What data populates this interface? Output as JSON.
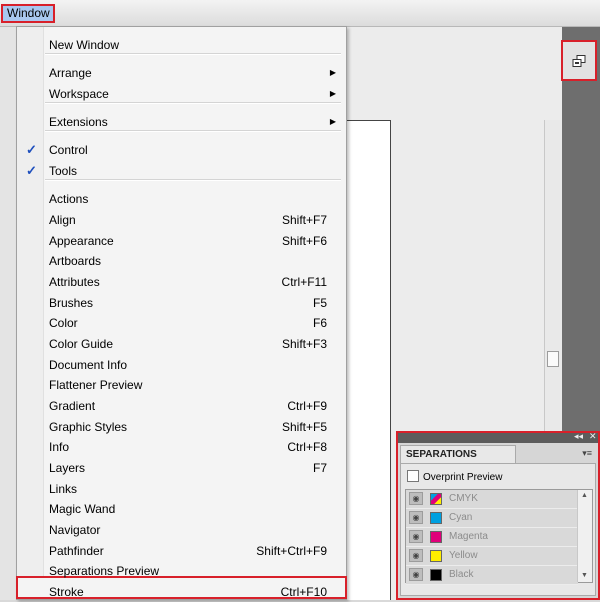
{
  "menubar": {
    "window_label": "Window"
  },
  "menu": {
    "items": [
      {
        "label": "New Window",
        "shortcut": "",
        "submenu": false,
        "checked": false
      },
      {
        "label": "Arrange",
        "shortcut": "",
        "submenu": true,
        "checked": false
      },
      {
        "label": "Workspace",
        "shortcut": "",
        "submenu": true,
        "checked": false
      },
      {
        "label": "Extensions",
        "shortcut": "",
        "submenu": true,
        "checked": false
      },
      {
        "label": "Control",
        "shortcut": "",
        "submenu": false,
        "checked": true
      },
      {
        "label": "Tools",
        "shortcut": "",
        "submenu": false,
        "checked": true
      },
      {
        "label": "Actions",
        "shortcut": "",
        "submenu": false,
        "checked": false
      },
      {
        "label": "Align",
        "shortcut": "Shift+F7",
        "submenu": false,
        "checked": false
      },
      {
        "label": "Appearance",
        "shortcut": "Shift+F6",
        "submenu": false,
        "checked": false
      },
      {
        "label": "Artboards",
        "shortcut": "",
        "submenu": false,
        "checked": false
      },
      {
        "label": "Attributes",
        "shortcut": "Ctrl+F11",
        "submenu": false,
        "checked": false
      },
      {
        "label": "Brushes",
        "shortcut": "F5",
        "submenu": false,
        "checked": false
      },
      {
        "label": "Color",
        "shortcut": "F6",
        "submenu": false,
        "checked": false
      },
      {
        "label": "Color Guide",
        "shortcut": "Shift+F3",
        "submenu": false,
        "checked": false
      },
      {
        "label": "Document Info",
        "shortcut": "",
        "submenu": false,
        "checked": false
      },
      {
        "label": "Flattener Preview",
        "shortcut": "",
        "submenu": false,
        "checked": false
      },
      {
        "label": "Gradient",
        "shortcut": "Ctrl+F9",
        "submenu": false,
        "checked": false
      },
      {
        "label": "Graphic Styles",
        "shortcut": "Shift+F5",
        "submenu": false,
        "checked": false
      },
      {
        "label": "Info",
        "shortcut": "Ctrl+F8",
        "submenu": false,
        "checked": false
      },
      {
        "label": "Layers",
        "shortcut": "F7",
        "submenu": false,
        "checked": false
      },
      {
        "label": "Links",
        "shortcut": "",
        "submenu": false,
        "checked": false
      },
      {
        "label": "Magic Wand",
        "shortcut": "",
        "submenu": false,
        "checked": false
      },
      {
        "label": "Navigator",
        "shortcut": "",
        "submenu": false,
        "checked": false
      },
      {
        "label": "Pathfinder",
        "shortcut": "Shift+Ctrl+F9",
        "submenu": false,
        "checked": false
      },
      {
        "label": "Separations Preview",
        "shortcut": "",
        "submenu": false,
        "checked": false,
        "highlighted": true
      },
      {
        "label": "Stroke",
        "shortcut": "Ctrl+F10",
        "submenu": false,
        "checked": false
      }
    ],
    "check_glyph": "✓",
    "arrow_glyph": "▶"
  },
  "separations_panel": {
    "title": "SEPARATIONS PREVIEW",
    "overprint_label": "Overprint Preview",
    "inks": [
      {
        "name": "CMYK",
        "color": "multi"
      },
      {
        "name": "Cyan",
        "color": "#00a0e0"
      },
      {
        "name": "Magenta",
        "color": "#e0007a"
      },
      {
        "name": "Yellow",
        "color": "#ffee00"
      },
      {
        "name": "Black",
        "color": "#000000"
      }
    ],
    "collapse_glyph": "◂◂",
    "close_glyph": "✕",
    "menu_glyph": "▾≡"
  },
  "colors": {
    "highlight_border": "#d8202a",
    "check_color": "#1e4fbd"
  }
}
